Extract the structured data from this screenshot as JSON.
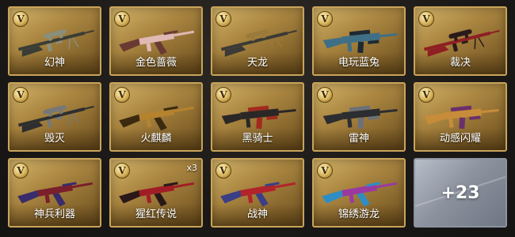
{
  "badge_letter": "V",
  "items": [
    {
      "name": "幻神",
      "icon": "sniper-rifle-icon",
      "color": "#3a3d35",
      "accent": "#8a8f7a",
      "shape": "sniper",
      "count": ""
    },
    {
      "name": "金色蔷薇",
      "icon": "assault-rifle-icon",
      "color": "#e0b9b4",
      "accent": "#6a3a32",
      "shape": "ak",
      "count": ""
    },
    {
      "name": "天龙",
      "icon": "sniper-rifle-icon",
      "color": "#3b3a36",
      "accent": "#9a7a3a",
      "shape": "sniper",
      "count": ""
    },
    {
      "name": "电玩蓝兔",
      "icon": "assault-rifle-icon",
      "color": "#3f6f86",
      "accent": "#1d2a33",
      "shape": "m4",
      "count": ""
    },
    {
      "name": "裁决",
      "icon": "sniper-rifle-icon",
      "color": "#8e1f22",
      "accent": "#2a1a1a",
      "shape": "sniper",
      "count": ""
    },
    {
      "name": "毁灭",
      "icon": "heavy-sniper-icon",
      "color": "#2e2e2e",
      "accent": "#777777",
      "shape": "sniper",
      "count": ""
    },
    {
      "name": "火麒麟",
      "icon": "assault-rifle-icon",
      "color": "#b5832e",
      "accent": "#3b2a10",
      "shape": "ak",
      "count": ""
    },
    {
      "name": "黑骑士",
      "icon": "assault-rifle-icon",
      "color": "#2a2726",
      "accent": "#a32a1e",
      "shape": "m4",
      "count": ""
    },
    {
      "name": "雷神",
      "icon": "assault-rifle-icon",
      "color": "#2b2d30",
      "accent": "#6c7078",
      "shape": "m4",
      "count": ""
    },
    {
      "name": "动感闪耀",
      "icon": "assault-rifle-icon",
      "color": "#c78c3a",
      "accent": "#6b2f6a",
      "shape": "m4",
      "count": ""
    },
    {
      "name": "神兵利器",
      "icon": "assault-rifle-icon",
      "color": "#7a1f2b",
      "accent": "#3a2b6a",
      "shape": "ak",
      "count": ""
    },
    {
      "name": "猩红传说",
      "icon": "assault-rifle-icon",
      "color": "#a11d25",
      "accent": "#2a1818",
      "shape": "ak",
      "count": "x3"
    },
    {
      "name": "战神",
      "icon": "assault-rifle-icon",
      "color": "#b3232a",
      "accent": "#3a3f86",
      "shape": "ak",
      "count": ""
    },
    {
      "name": "锦绣游龙",
      "icon": "assault-rifle-icon",
      "color": "#9a3aa0",
      "accent": "#2e8ec4",
      "shape": "ak",
      "count": ""
    }
  ],
  "more": {
    "label": "+23"
  }
}
